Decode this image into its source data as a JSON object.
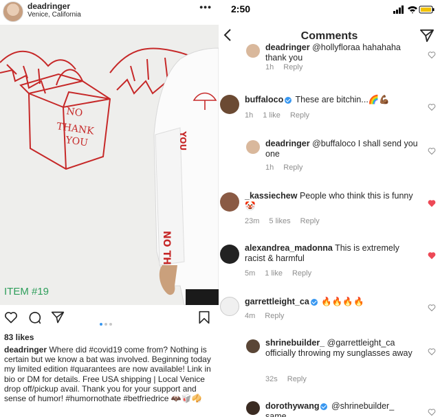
{
  "post": {
    "username": "deadringer",
    "location": "Venice, California",
    "item_label": "ITEM #19",
    "box_text": [
      "NO",
      "THANK",
      "YOU"
    ],
    "sleeve_text": "NO THANK",
    "likes": "83 likes",
    "caption_user": "deadringer",
    "caption_text": "Where did #covid19 come from? Nothing is certain but we know a bat was involved. Beginning today my limited edition #quarantees are now available! Link in bio or DM for details. Free USA shipping | Local Venice drop off/pickup avail. Thank you for your support and sense of humor! #humornothate #betfriedrice",
    "caption_emojis": "🦇🥡🥠",
    "carousel_dots": 3,
    "carousel_active": 1
  },
  "status": {
    "time": "2:50"
  },
  "nav": {
    "title": "Comments"
  },
  "comments": [
    {
      "user": "deadringer",
      "text": "@hollyfloraa hahahaha thank you",
      "time": "1h",
      "likes": "",
      "reply": "Reply",
      "liked": false,
      "avatar_color": "#d9b89c"
    },
    {
      "user": "buffaloco",
      "verified": true,
      "text": "These are bitchin...🌈💪🏾",
      "time": "1h",
      "likes": "1 like",
      "reply": "Reply",
      "liked": false,
      "avatar_color": "#6b4a33"
    },
    {
      "user": "deadringer",
      "text": "@buffaloco I shall send you one",
      "time": "1h",
      "likes": "",
      "reply": "Reply",
      "liked": false,
      "avatar_color": "#d9b89c"
    },
    {
      "user": "_kassiechew",
      "text": "People who think this is funny 🤡",
      "time": "23m",
      "likes": "5 likes",
      "reply": "Reply",
      "liked": true,
      "avatar_color": "#8a5a44"
    },
    {
      "user": "alexandrea_madonna",
      "text": "This is extremely racist & harmful",
      "time": "5m",
      "likes": "1 like",
      "reply": "Reply",
      "liked": true,
      "avatar_color": "#222222"
    },
    {
      "user": "garrettleight_ca",
      "verified": true,
      "text": "🔥🔥🔥🔥",
      "time": "4m",
      "likes": "",
      "reply": "Reply",
      "liked": false,
      "avatar_color": "#f0f0f0"
    },
    {
      "user": "shrinebuilder_",
      "text": "@garrettleight_ca officially throwing my sunglasses away",
      "time": "32s",
      "likes": "",
      "reply": "Reply",
      "liked": false,
      "avatar_color": "#5a4636"
    },
    {
      "user": "dorothywang",
      "verified": true,
      "text": "@shrinebuilder_ same",
      "time": "",
      "likes": "",
      "reply": "",
      "liked": false,
      "avatar_color": "#3a2b22"
    }
  ],
  "colors": {
    "accent": "#3897f0",
    "liked_heart": "#ed4956",
    "item_green": "#2e9e5b",
    "drawing_red": "#c62828"
  },
  "icons": [
    "more-icon",
    "heart-icon",
    "comment-icon",
    "share-icon",
    "bookmark-icon",
    "back-icon",
    "direct-send-icon",
    "signal-icon",
    "wifi-icon",
    "battery-icon"
  ]
}
